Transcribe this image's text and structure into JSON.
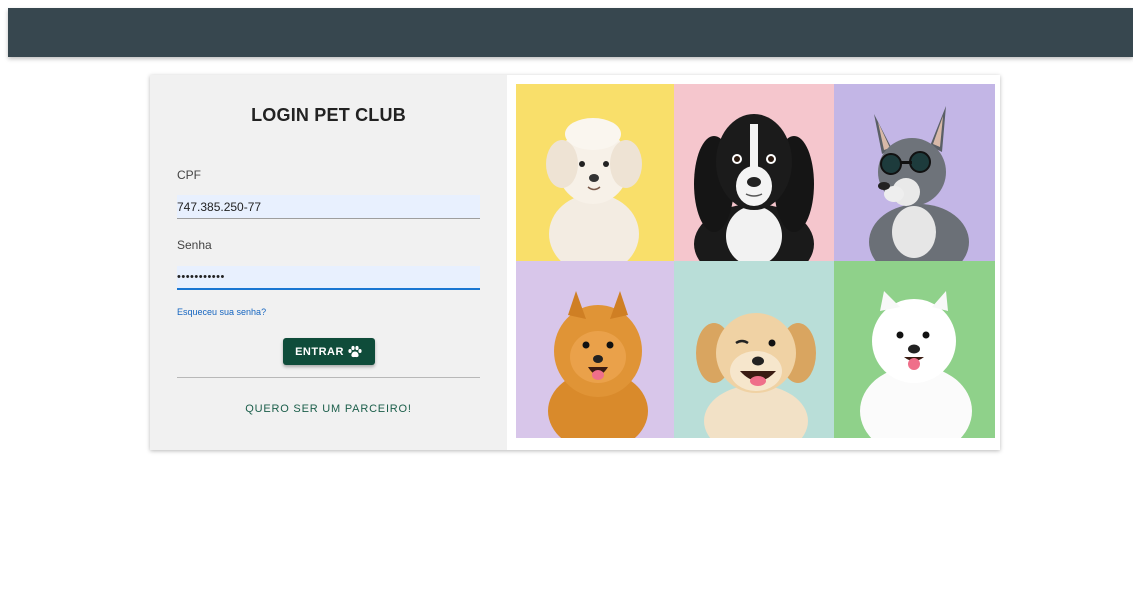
{
  "login": {
    "title": "LOGIN PET CLUB",
    "cpf_label": "CPF",
    "cpf_value": "747.385.250-77",
    "senha_label": "Senha",
    "senha_value": "•••••••••••",
    "forgot_link": "Esqueceu sua senha?",
    "enter_button": "ENTRAR",
    "enter_icon": "paw-icon",
    "partner_link": "QUERO SER UM PARCEIRO!"
  },
  "colors": {
    "topbar": "#37474f",
    "button": "#0f4c3a",
    "link": "#1565c0",
    "partner": "#1b5e4a",
    "input_bg": "#e8f0fe",
    "input_focus": "#1976d2"
  },
  "photos": [
    {
      "subject": "white-poodle",
      "background": "#f9df6a"
    },
    {
      "subject": "black-white-spaniel",
      "background": "#f5c6cd"
    },
    {
      "subject": "husky-with-sunglasses",
      "background": "#c3b6e6"
    },
    {
      "subject": "pomeranian",
      "background": "#d8c6ea"
    },
    {
      "subject": "golden-spaniel",
      "background": "#b9ded8"
    },
    {
      "subject": "white-samoyed",
      "background": "#8fd18a"
    }
  ]
}
